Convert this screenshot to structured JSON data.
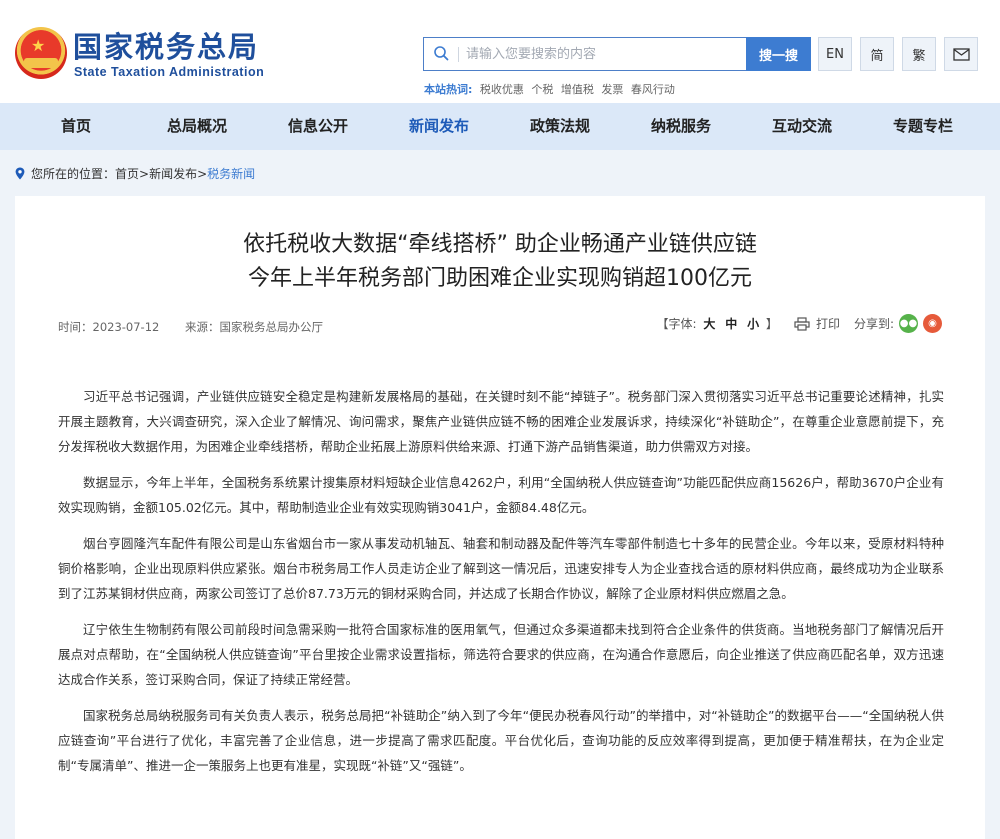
{
  "header": {
    "brand_cn": "国家税务总局",
    "brand_en": "State Taxation Administration",
    "search_placeholder": "请输入您要搜索的内容",
    "search_button": "搜一搜",
    "hot_label": "本站热词:",
    "hot_words": [
      "税收优惠",
      "个税",
      "增值税",
      "发票",
      "春风行动"
    ],
    "lang_en": "EN",
    "lang_simplified": "简",
    "lang_traditional": "繁"
  },
  "nav": {
    "items": [
      "首页",
      "总局概况",
      "信息公开",
      "新闻发布",
      "政策法规",
      "纳税服务",
      "互动交流",
      "专题专栏"
    ],
    "active": "新闻发布"
  },
  "breadcrumb": {
    "prefix": "您所在的位置：",
    "path": "首页>新闻发布>",
    "current": "税务新闻"
  },
  "article": {
    "title_line1": "依托税收大数据“牵线搭桥” 助企业畅通产业链供应链",
    "title_line2": "今年上半年税务部门助困难企业实现购销超100亿元",
    "date": "时间：2023-07-12",
    "source": "来源：国家税务总局办公厅",
    "font_size_label": "【字体:",
    "font_large": "大",
    "font_medium": "中",
    "font_small": "小",
    "font_close": "】",
    "print_label": "打印",
    "share_label": "分享到:",
    "paragraphs": [
      "习近平总书记强调，产业链供应链安全稳定是构建新发展格局的基础，在关键时刻不能“掉链子”。税务部门深入贯彻落实习近平总书记重要论述精神，扎实开展主题教育，大兴调查研究，深入企业了解情况、询问需求，聚焦产业链供应链不畅的困难企业发展诉求，持续深化“补链助企”，在尊重企业意愿前提下，充分发挥税收大数据作用，为困难企业牵线搭桥，帮助企业拓展上游原料供给来源、打通下游产品销售渠道，助力供需双方对接。",
      "数据显示，今年上半年，全国税务系统累计搜集原材料短缺企业信息4262户，利用“全国纳税人供应链查询”功能匹配供应商15626户，帮助3670户企业有效实现购销，金额105.02亿元。其中，帮助制造业企业有效实现购销3041户，金额84.48亿元。",
      "烟台亨圆隆汽车配件有限公司是山东省烟台市一家从事发动机轴瓦、轴套和制动器及配件等汽车零部件制造七十多年的民营企业。今年以来，受原材料特种铜价格影响，企业出现原料供应紧张。烟台市税务局工作人员走访企业了解到这一情况后，迅速安排专人为企业查找合适的原材料供应商，最终成功为企业联系到了江苏某铜材供应商，两家公司签订了总价87.73万元的铜材采购合同，并达成了长期合作协议，解除了企业原材料供应燃眉之急。",
      "辽宁依生生物制药有限公司前段时间急需采购一批符合国家标准的医用氧气，但通过众多渠道都未找到符合企业条件的供货商。当地税务部门了解情况后开展点对点帮助，在“全国纳税人供应链查询”平台里按企业需求设置指标，筛选符合要求的供应商，在沟通合作意愿后，向企业推送了供应商匹配名单，双方迅速达成合作关系，签订采购合同，保证了持续正常经营。",
      "国家税务总局纳税服务司有关负责人表示，税务总局把“补链助企”纳入到了今年“便民办税春风行动”的举措中，对“补链助企”的数据平台——“全国纳税人供应链查询”平台进行了优化，丰富完善了企业信息，进一步提高了需求匹配度。平台优化后，查询功能的反应效率得到提高，更加便于精准帮扶，在为企业定制“专属清单”、推进一企一策服务上也更有准星，实现既“补链”又“强链”。"
    ]
  }
}
